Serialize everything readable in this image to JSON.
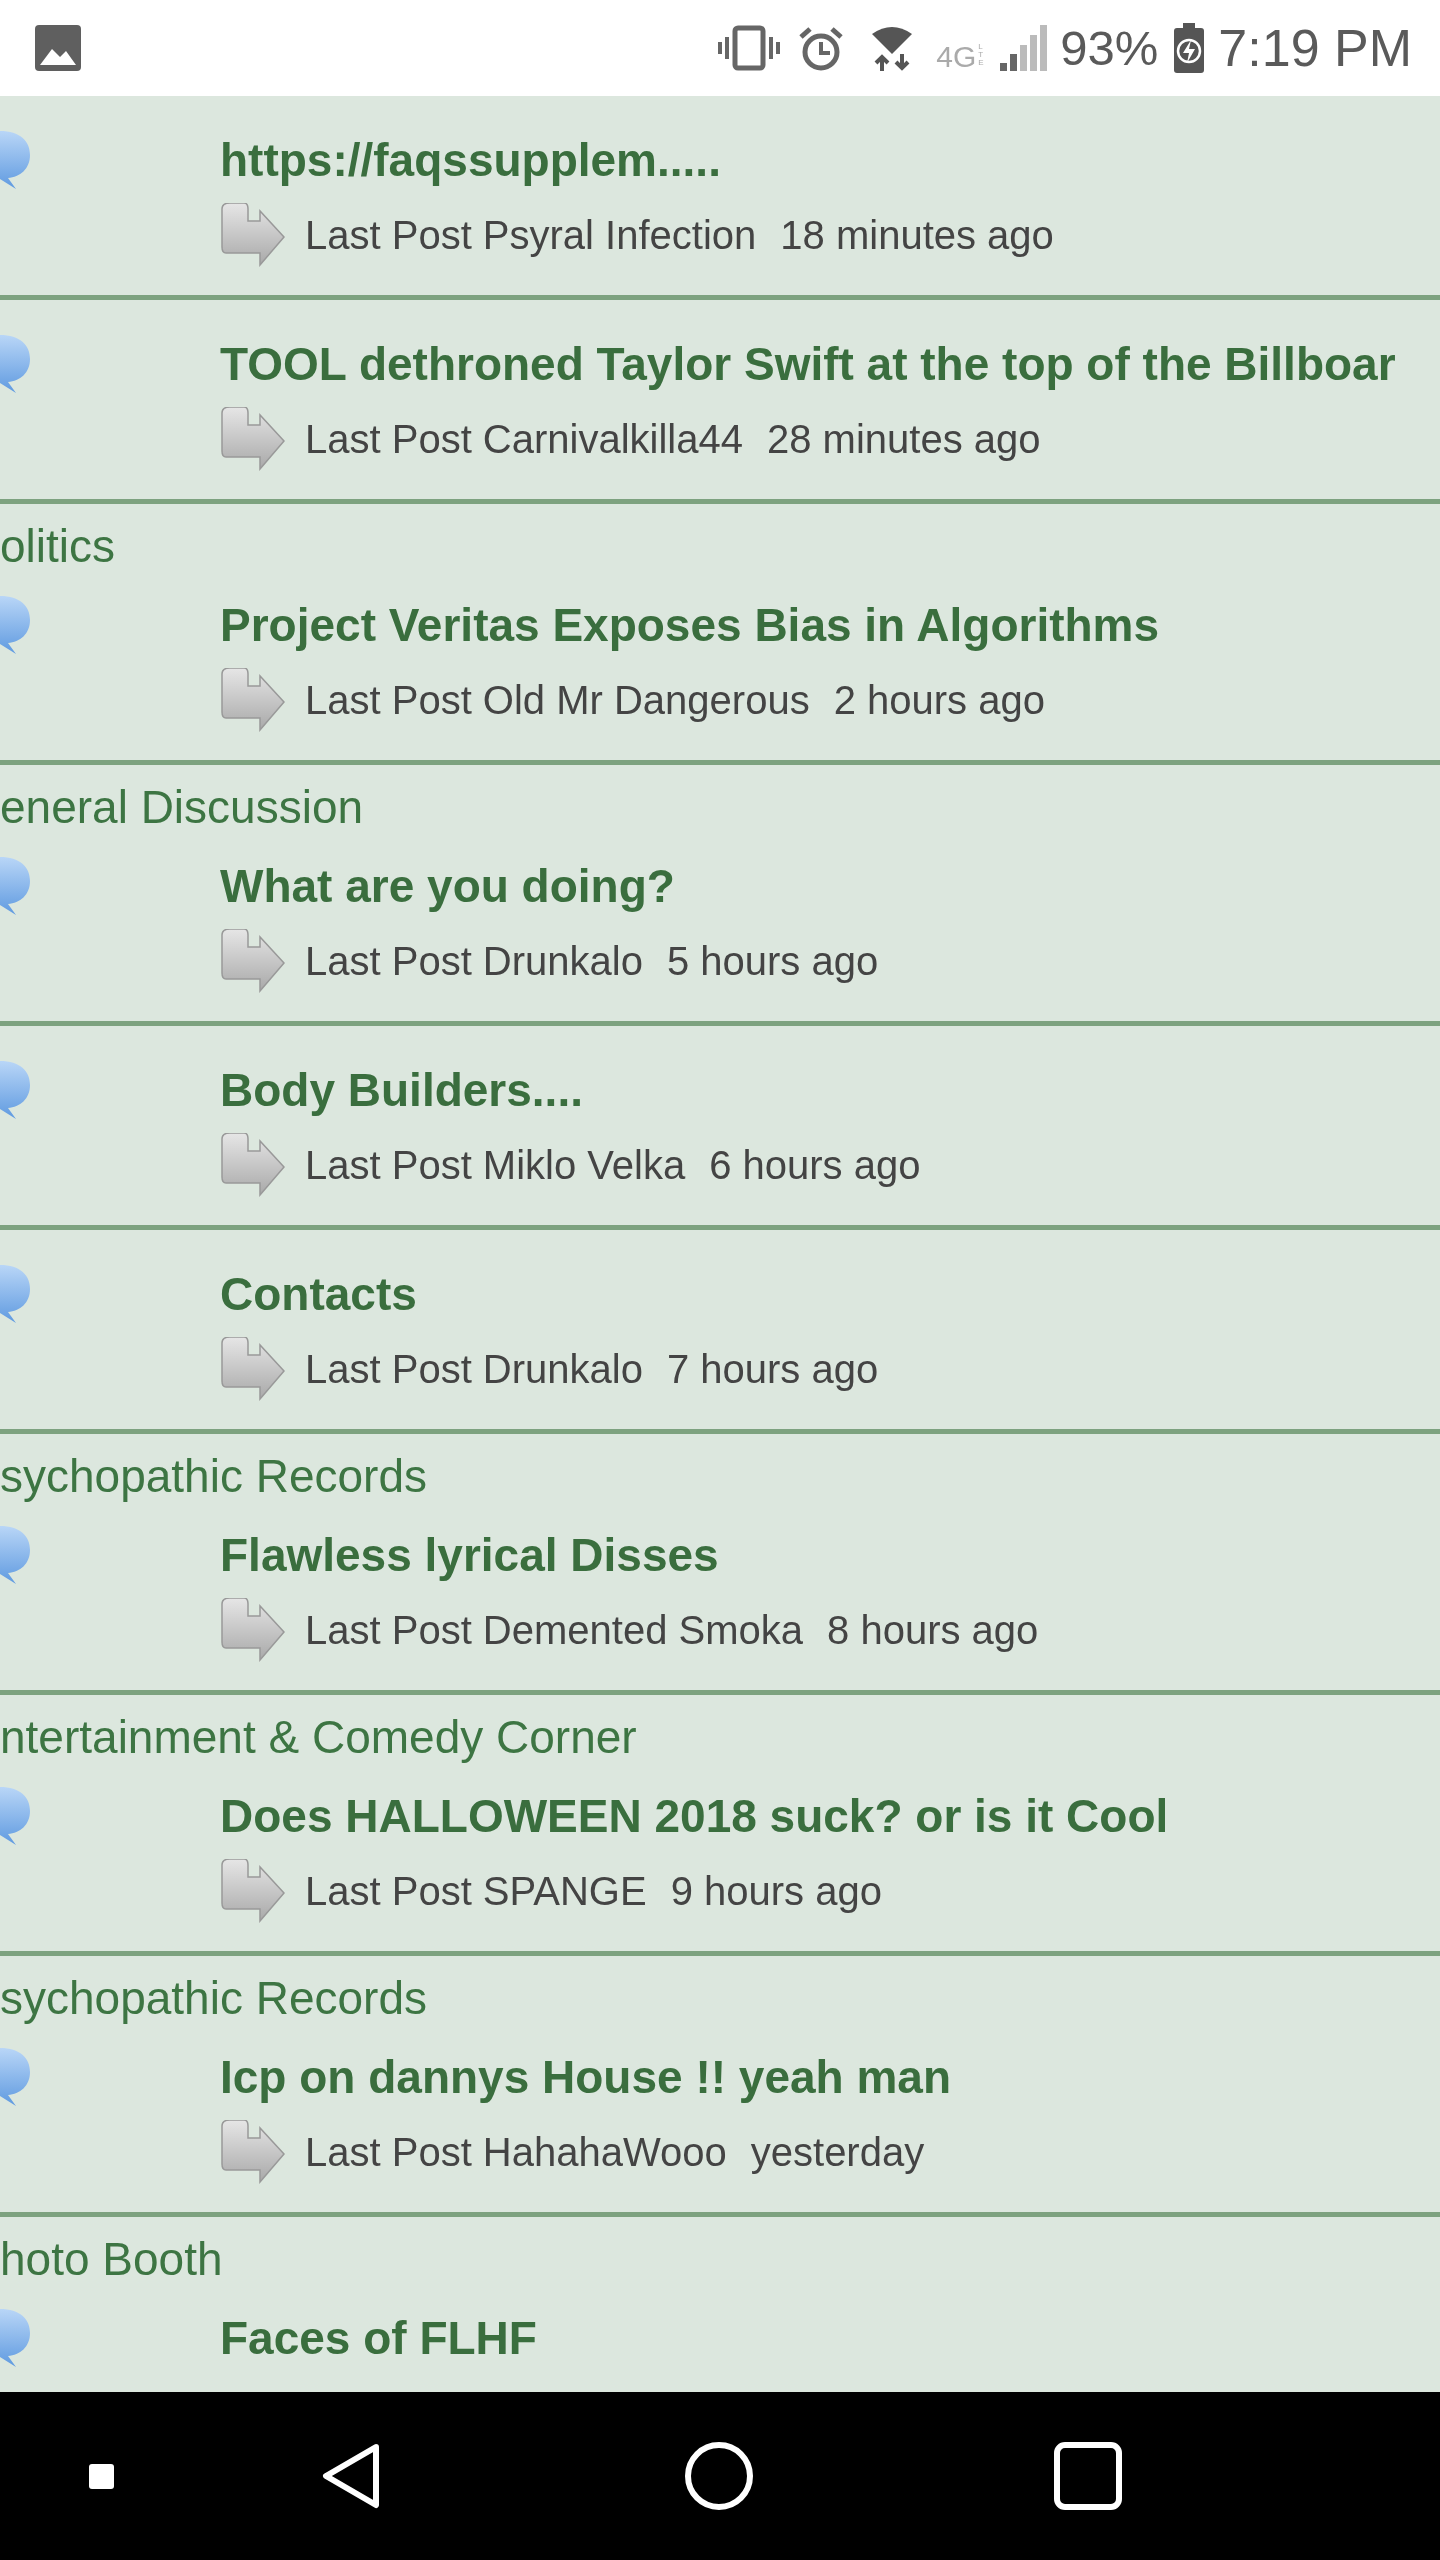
{
  "status_bar": {
    "network": "4G",
    "network_sub": "LTE",
    "battery": "93%",
    "time": "7:19 PM"
  },
  "topics": [
    {
      "title": "https://faqssupplem.....",
      "last_post": "Last Post Psyral Infection",
      "time": "18 minutes ago"
    },
    {
      "title": "TOOL dethroned Taylor Swift at the top of the Billboar",
      "last_post": "Last Post Carnivalkilla44",
      "time": "28 minutes ago"
    },
    {
      "category": "olitics",
      "title": "Project Veritas Exposes Bias in Algorithms",
      "last_post": "Last Post Old Mr Dangerous",
      "time": "2 hours ago"
    },
    {
      "category": "eneral Discussion",
      "title": "What are you doing?",
      "last_post": "Last Post Drunkalo",
      "time": "5 hours ago"
    },
    {
      "title": "Body Builders....",
      "last_post": "Last Post Miklo Velka",
      "time": "6 hours ago"
    },
    {
      "title": "Contacts",
      "last_post": "Last Post Drunkalo",
      "time": "7 hours ago"
    },
    {
      "category": "sychopathic Records",
      "title": "Flawless lyrical Disses",
      "last_post": "Last Post Demented Smoka",
      "time": "8 hours ago"
    },
    {
      "category": "ntertainment & Comedy Corner",
      "title": "Does HALLOWEEN 2018 suck? or is it Cool",
      "last_post": "Last Post SPANGE",
      "time": "9 hours ago"
    },
    {
      "category": "sychopathic Records",
      "title": "Icp on dannys House !! yeah man",
      "last_post": "Last Post HahahaWooo",
      "time": "yesterday"
    },
    {
      "category": "hoto Booth",
      "title": "Faces of FLHF"
    }
  ]
}
